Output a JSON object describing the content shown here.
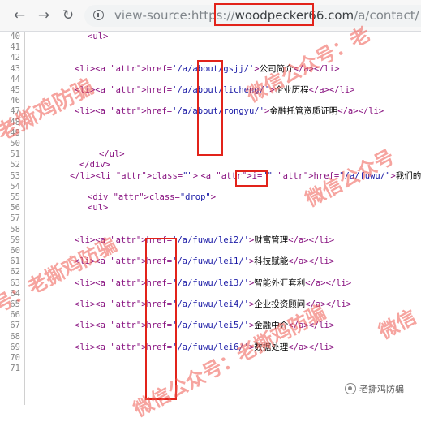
{
  "toolbar": {
    "back_icon": "back-arrow-icon",
    "forward_icon": "forward-arrow-icon",
    "reload_icon": "reload-icon",
    "info_icon": "info-icon",
    "url_prefix": "view-source:https://",
    "url_domain": "woodpecker66.com",
    "url_path": "/a/contact/"
  },
  "source_lines": [
    {
      "n": "40",
      "code": "<ul>"
    },
    {
      "n": "41",
      "code": ""
    },
    {
      "n": "42",
      "code": ""
    },
    {
      "n": "43",
      "code": "<li><a href='/a/about/gsjj/'>公司简介</a></li>"
    },
    {
      "n": "44",
      "code": ""
    },
    {
      "n": "45",
      "code": "<li><a href='/a/about/licheng/'>企业历程</a></li>"
    },
    {
      "n": "46",
      "code": ""
    },
    {
      "n": "47",
      "code": "<li><a href='/a/about/rongyu/'>金融托管资质证明</a></li>"
    },
    {
      "n": "48",
      "code": ""
    },
    {
      "n": "49",
      "code": ""
    },
    {
      "n": "50",
      "code": ""
    },
    {
      "n": "51",
      "code": "</ul>"
    },
    {
      "n": "52",
      "code": "</div>"
    },
    {
      "n": "53",
      "code": "</li><li class=\"\"> <a i=\"\" href=\"/a/fuwu/\">我们的服务</a>"
    },
    {
      "n": "54",
      "code": ""
    },
    {
      "n": "55",
      "code": "<div class=\"drop\">"
    },
    {
      "n": "56",
      "code": "<ul>"
    },
    {
      "n": "57",
      "code": ""
    },
    {
      "n": "58",
      "code": ""
    },
    {
      "n": "59",
      "code": "<li><a href='/a/fuwu/lei2/'>财富管理</a></li>"
    },
    {
      "n": "60",
      "code": ""
    },
    {
      "n": "61",
      "code": "<li><a href='/a/fuwu/lei1/'>科技赋能</a></li>"
    },
    {
      "n": "62",
      "code": ""
    },
    {
      "n": "63",
      "code": "<li><a href='/a/fuwu/lei3/'>智能外汇套利</a></li>"
    },
    {
      "n": "64",
      "code": ""
    },
    {
      "n": "65",
      "code": "<li><a href='/a/fuwu/lei4/'>企业投资顾问</a></li>"
    },
    {
      "n": "66",
      "code": ""
    },
    {
      "n": "67",
      "code": "<li><a href='/a/fuwu/lei5/'>金融中介</a></li>"
    },
    {
      "n": "68",
      "code": ""
    },
    {
      "n": "69",
      "code": "<li><a href='/a/fuwu/lei6/'>数据处理</a></li>"
    },
    {
      "n": "70",
      "code": ""
    },
    {
      "n": "71",
      "code": ""
    }
  ],
  "watermark": {
    "text_a": "老撕鸡防骗",
    "text_b": "微信公众号",
    "text_c": "众号：老撕鸡防骗",
    "text_d": "微信公众号：老撕鸡防骗",
    "text_e": "微信公众号：老",
    "text_f": "微信公众号",
    "text_g": "微信"
  },
  "logo": {
    "icon": "wechat-account-icon",
    "text": "老撕鸡防骗"
  },
  "colors": {
    "highlight": "#e2231a",
    "watermark": "#f05a52",
    "tag": "#881280",
    "attr": "#994500",
    "value": "#1a1aa6"
  }
}
